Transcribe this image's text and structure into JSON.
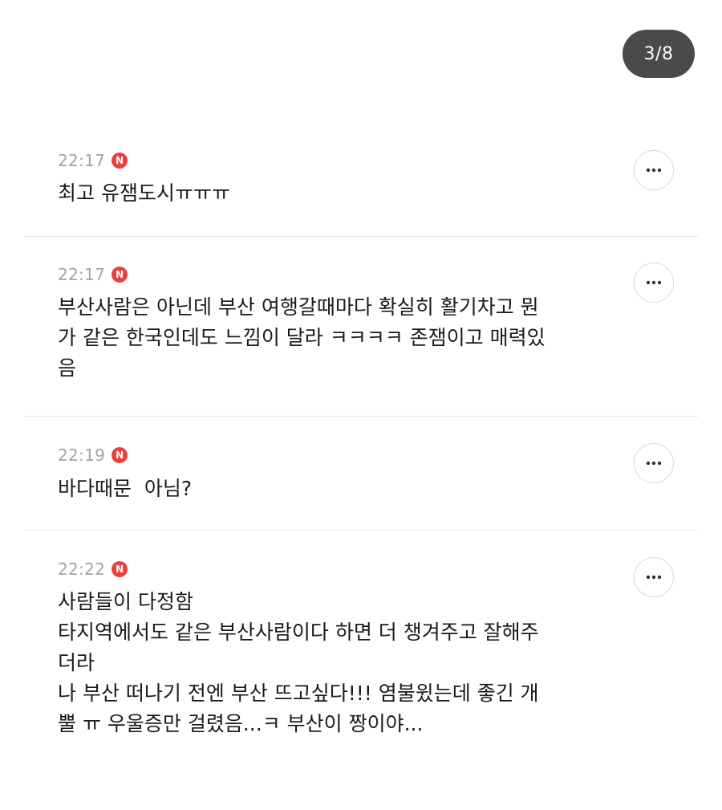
{
  "page_counter": "3/8",
  "badge_letter": "N",
  "accent_color": "#e8423f",
  "comments": [
    {
      "time": "22:17",
      "lines": [
        "최고 유잼도시ㅠㅠㅠ"
      ]
    },
    {
      "time": "22:17",
      "lines": [
        "부산사람은 아닌데 부산 여행갈때마다 확실히 활기차고 뭔",
        "가 같은 한국인데도 느낌이 달라 ㅋㅋㅋㅋ 존잼이고 매력있",
        "음"
      ]
    },
    {
      "time": "22:19",
      "lines": [
        "바다때문  아님?"
      ]
    },
    {
      "time": "22:22",
      "lines": [
        "사람들이 다정함",
        "타지역에서도 같은 부산사람이다 하면 더 챙겨주고 잘해주",
        "더라",
        "나 부산 떠나기 전엔 부산 뜨고싶다!!! 염불윘는데 좋긴 개",
        "뿔 ㅠ 우울증만 걸렸음...ㅋ 부산이 짱이야..."
      ]
    }
  ]
}
